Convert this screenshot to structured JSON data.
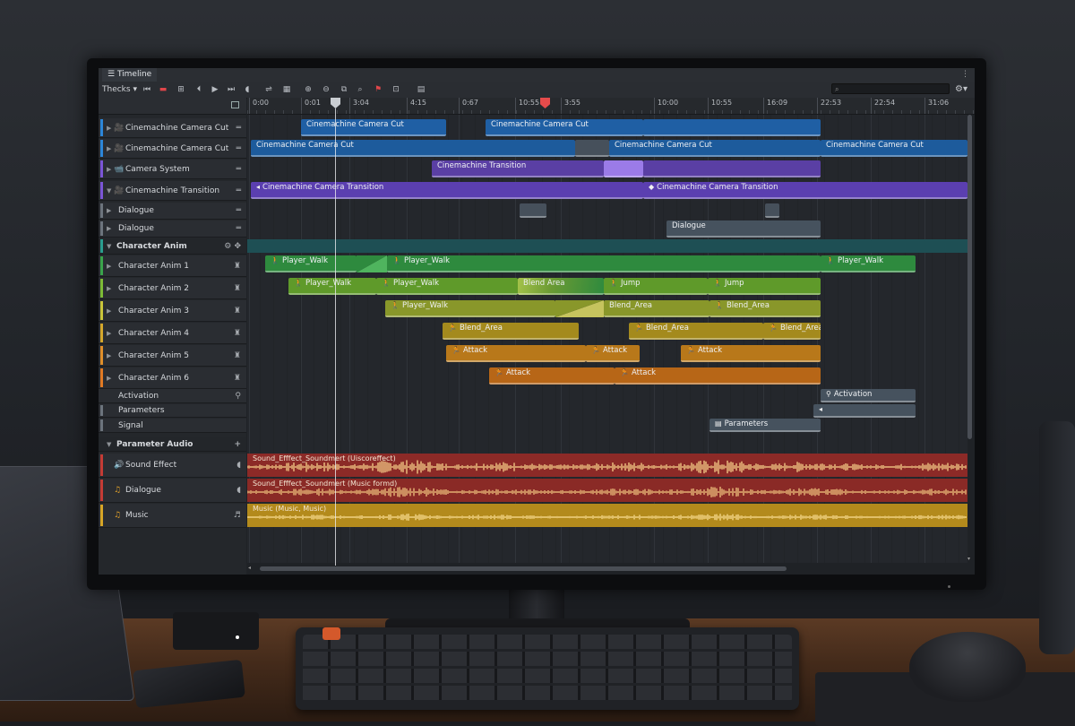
{
  "window": {
    "title": "Timeline"
  },
  "toolbar": {
    "dropdown_label": "Thecks ▾",
    "search_placeholder": "",
    "buttons": [
      "preview-icon",
      "record-icon",
      "frame-icon",
      "goto-start-icon",
      "play-icon",
      "goto-end-icon",
      "loop-icon",
      "audio-icon",
      "grid-icon",
      "zoom-in-icon",
      "zoom-out-icon",
      "search-icon",
      "flag-icon",
      "layout-icon",
      "table-icon"
    ]
  },
  "ruler": {
    "ticks": [
      "0:00",
      "0:01",
      "3:04",
      "4:15",
      "0:67",
      "10:55",
      "3:55",
      "10:00",
      "10:55",
      "16:09",
      "22:53",
      "22:54",
      "31:06"
    ]
  },
  "tracks": [
    {
      "label": "Cinemachine Camera Cut",
      "icon": "camera-icon",
      "color": "#2c86d8"
    },
    {
      "label": "Cinemachine Camera Cut",
      "icon": "camera-icon",
      "color": "#2c86d8"
    },
    {
      "label": "Camera System",
      "icon": "video-icon",
      "color": "#7b55d6"
    },
    {
      "label": "Cinemachine Transition",
      "icon": "camera-icon",
      "color": "#7b55d6"
    },
    {
      "label": "Dialogue",
      "icon": "",
      "color": "#6c747d"
    },
    {
      "label": "Dialogue",
      "icon": "",
      "color": "#6c747d"
    },
    {
      "label": "Character Anim",
      "icon": "",
      "color": "#2a9d8f"
    },
    {
      "label": "Character Anim 1",
      "icon": "",
      "color": "#3aa44b"
    },
    {
      "label": "Character Anim 2",
      "icon": "",
      "color": "#7dbb36"
    },
    {
      "label": "Character Anim 3",
      "icon": "",
      "color": "#c9c53a"
    },
    {
      "label": "Character Anim 4",
      "icon": "",
      "color": "#d4a72c"
    },
    {
      "label": "Character Anim 5",
      "icon": "",
      "color": "#e08f2a"
    },
    {
      "label": "Character Anim 6",
      "icon": "",
      "color": "#e07a24"
    },
    {
      "label": "Activation",
      "icon": "",
      "color": ""
    },
    {
      "label": "Parameters",
      "icon": "",
      "color": "#6c747d"
    },
    {
      "label": "Signal",
      "icon": "",
      "color": "#6c747d"
    },
    {
      "label": "Parameter Audio",
      "icon": "",
      "color": ""
    },
    {
      "label": "Sound Effect",
      "icon": "speaker-icon",
      "color": "#c43b35"
    },
    {
      "label": "Dialogue",
      "icon": "note-icon",
      "color": "#c43b35"
    },
    {
      "label": "Music",
      "icon": "note-icon",
      "color": "#d6a526"
    }
  ],
  "clips": {
    "cut1_a": "Cinemachine Camera Cut",
    "cut1_b": "Cinemachine Camera Cut",
    "cut2_a": "Cinemachine Camera Cut",
    "cut2_b": "Cinemachine Camera Cut",
    "cut2_c": "Cinemachine Camera Cut",
    "transition": "Cinemachine Transition",
    "trans_a": "Cinemachine Camera Transition",
    "trans_b": "Cinemachine Camera Transition",
    "dialogue": "Dialogue",
    "a1_1": "Player_Walk",
    "a1_2": "Player_Walk",
    "a1_3": "Player_Walk",
    "a2_1": "Player_Walk",
    "a2_2": "Player_Walk",
    "a2_3": "Blend Area",
    "a2_4": "Jump",
    "a2_5": "Jump",
    "a3_1": "Player_Walk",
    "a3_2": "Blend_Area",
    "a3_3": "Blend_Area",
    "a4_1": "Blend_Area",
    "a4_2": "Blend_Area",
    "a4_3": "Blend_Area",
    "a5_1": "Attack",
    "a5_2": "Attack",
    "a5_3": "Attack",
    "a6_1": "Attack",
    "a6_2": "Attack",
    "activation": "Activation",
    "parameters": "Parameters"
  },
  "audio": {
    "sfx": "Sound_Efffect_Soundmert (Uiscoreffect)",
    "dialogue": "Sound_Efffect_Soundmert (Music formd)",
    "music": "Music (Music, Music)"
  },
  "colors": {
    "accent": "#2c86d8",
    "playhead": "#e54b4b"
  }
}
